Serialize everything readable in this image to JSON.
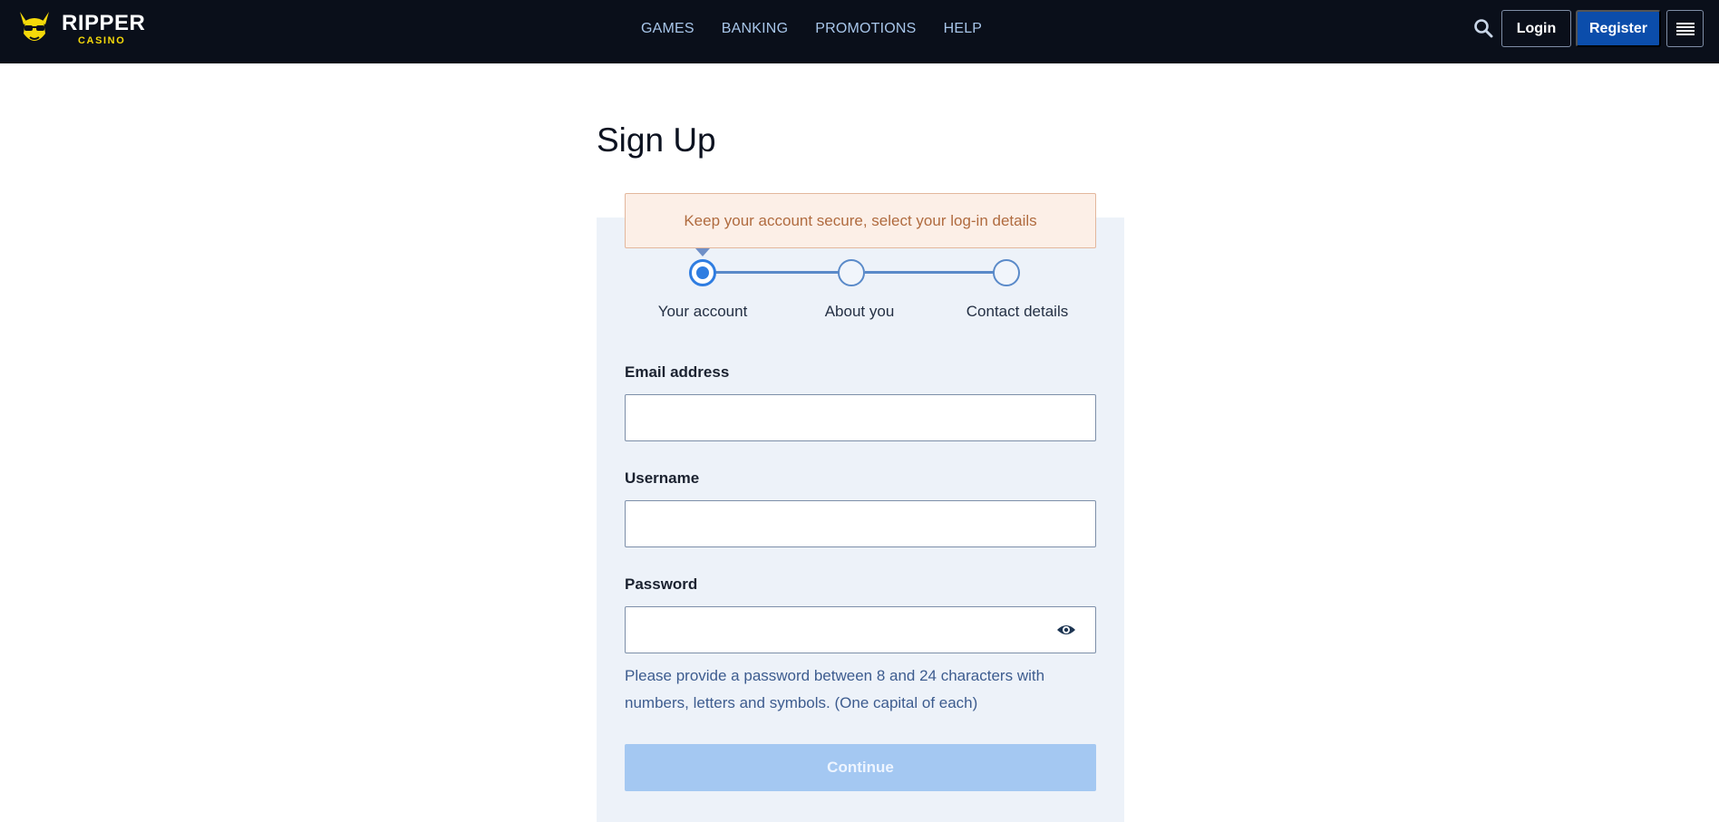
{
  "header": {
    "logo": {
      "brand": "RIPPER",
      "sub": "CASINO",
      "icon": "kangaroo-logo-icon"
    },
    "nav": [
      "GAMES",
      "BANKING",
      "PROMOTIONS",
      "HELP"
    ],
    "search_icon": "search-icon",
    "login_label": "Login",
    "register_label": "Register",
    "menu_icon": "hamburger-menu-icon"
  },
  "page": {
    "title": "Sign Up",
    "notice": "Keep your account secure, select your log-in details",
    "steps": [
      {
        "label": "Your account",
        "active": true
      },
      {
        "label": "About you",
        "active": false
      },
      {
        "label": "Contact details",
        "active": false
      }
    ],
    "form": {
      "email_label": "Email address",
      "email_value": "",
      "username_label": "Username",
      "username_value": "",
      "password_label": "Password",
      "password_value": "",
      "password_toggle_icon": "eye-icon",
      "password_hint": "Please provide a password between 8 and 24 characters with numbers, letters and symbols. (One capital of each)",
      "continue_label": "Continue"
    }
  },
  "colors": {
    "header_bg": "#0a0f1a",
    "nav_text": "#a8c6ea",
    "register_bg": "#0b4dab",
    "logo_yellow": "#f5d90a",
    "panel_bg": "#edf2f9",
    "notice_bg": "#fcefe7",
    "notice_text": "#b06b3f",
    "step_active": "#2f7de1",
    "continue_disabled": "#a4c8f2"
  }
}
